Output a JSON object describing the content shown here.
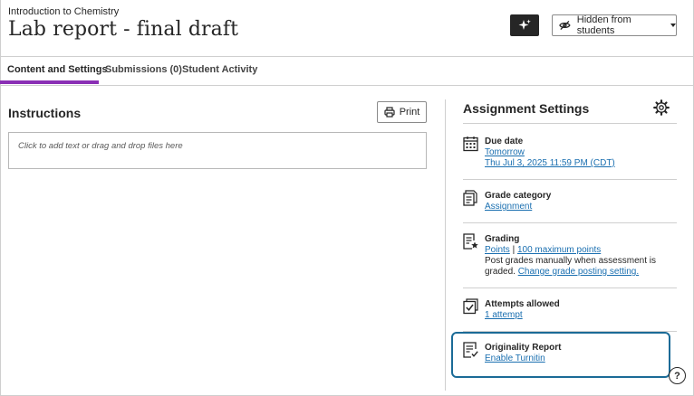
{
  "header": {
    "course_name": "Introduction to Chemistry",
    "page_title": "Lab report - final draft",
    "ai_icon": "sparkle-icon",
    "visibility_label": "Hidden from students",
    "visibility_icon": "eye-slash-icon"
  },
  "tabs": [
    {
      "label": "Content and Settings",
      "active": true
    },
    {
      "label": "Submissions (0)",
      "active": false
    },
    {
      "label": "Student Activity",
      "active": false
    }
  ],
  "instructions": {
    "title": "Instructions",
    "print_label": "Print",
    "placeholder": "Click to add text or drag and drop files here"
  },
  "settings": {
    "title": "Assignment Settings",
    "due_date": {
      "heading": "Due date",
      "relative": "Tomorrow",
      "datetime": "Thu Jul 3, 2025 11:59 PM (CDT)"
    },
    "grade_category": {
      "heading": "Grade category",
      "value": "Assignment"
    },
    "grading": {
      "heading": "Grading",
      "type": "Points",
      "separator": "|",
      "max_points": "100 maximum points",
      "note": "Post grades manually when assessment is graded.",
      "change_link": "Change grade posting setting."
    },
    "attempts": {
      "heading": "Attempts allowed",
      "value": "1 attempt"
    },
    "originality": {
      "heading": "Originality Report",
      "value": "Enable Turnitin"
    }
  },
  "help": {
    "label": "?"
  },
  "colors": {
    "accent_tab": "#8a2fb5",
    "link": "#1a6fb0",
    "focus_ring": "#1b6b97"
  }
}
